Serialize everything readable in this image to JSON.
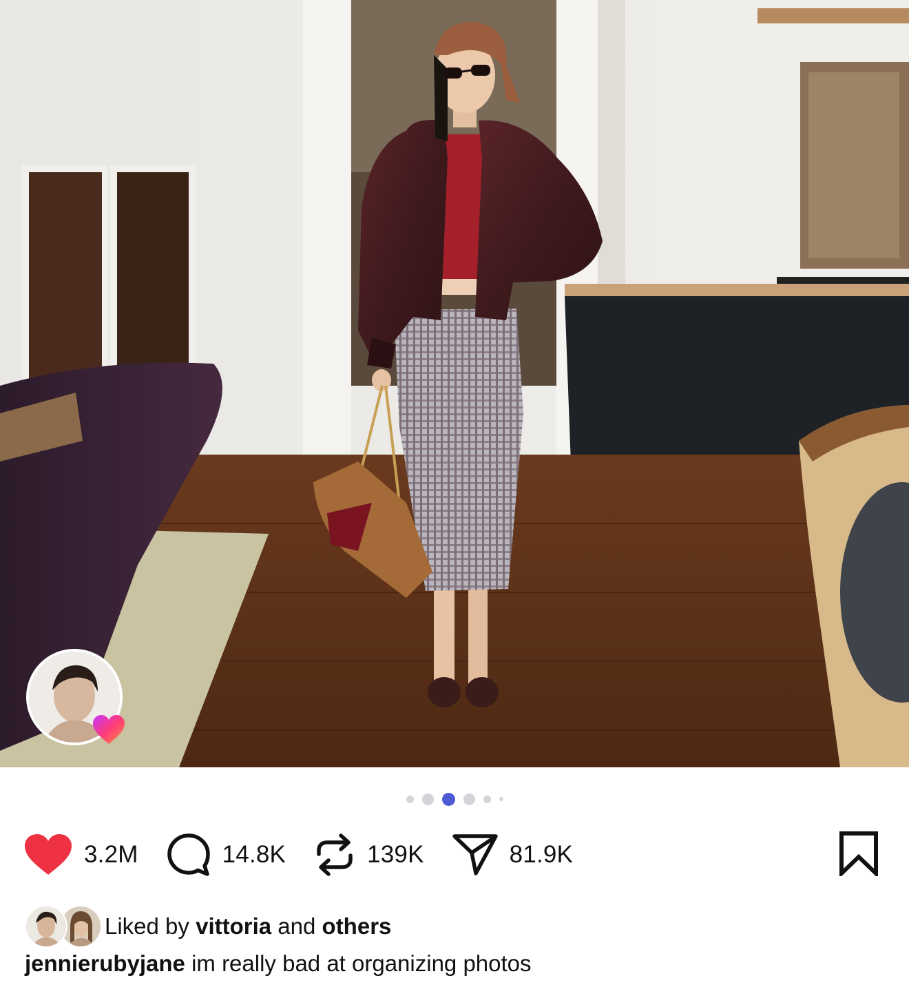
{
  "post": {
    "image_alt": "Person in brown leather bomber jacket and plaid skirt holding a tan bag in a room",
    "carousel": {
      "count": 6,
      "active_index": 2
    }
  },
  "actions": {
    "likes": "3.2M",
    "comments": "14.8K",
    "reposts": "139K",
    "shares": "81.9K"
  },
  "liked_by": {
    "prefix": "Liked by",
    "user": "vittoria",
    "conjunction": "and",
    "suffix": "others"
  },
  "caption": {
    "username": "jennierubyjane",
    "text": "im really bad at organizing photos"
  },
  "colors": {
    "like": "#ee3143",
    "dot_active": "#4f5bd5",
    "dot_inactive": "#d4d4d8"
  },
  "icons": [
    "heart-icon",
    "comment-icon",
    "repost-icon",
    "share-icon",
    "bookmark-icon"
  ]
}
